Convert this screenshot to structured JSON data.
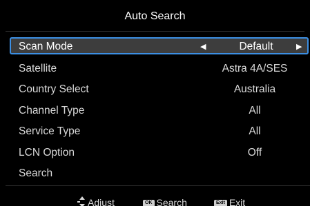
{
  "title": "Auto Search",
  "menu": {
    "items": [
      {
        "label": "Scan Mode",
        "value": "Default",
        "selected": true
      },
      {
        "label": "Satellite",
        "value": "Astra 4A/SES"
      },
      {
        "label": "Country Select",
        "value": "Australia"
      },
      {
        "label": "Channel Type",
        "value": "All"
      },
      {
        "label": "Service Type",
        "value": "All"
      },
      {
        "label": "LCN Option",
        "value": "Off"
      },
      {
        "label": "Search",
        "value": ""
      }
    ]
  },
  "footer": {
    "adjust": {
      "icon": "updown-arrow-icon",
      "label": "Adjust"
    },
    "search": {
      "key": "OK",
      "label": "Search"
    },
    "exit": {
      "key": "Exit",
      "label": "Exit"
    }
  },
  "colors": {
    "background": "#000000",
    "highlight_border": "#3c8fe3",
    "highlight_fill": "#3d3d3d"
  }
}
